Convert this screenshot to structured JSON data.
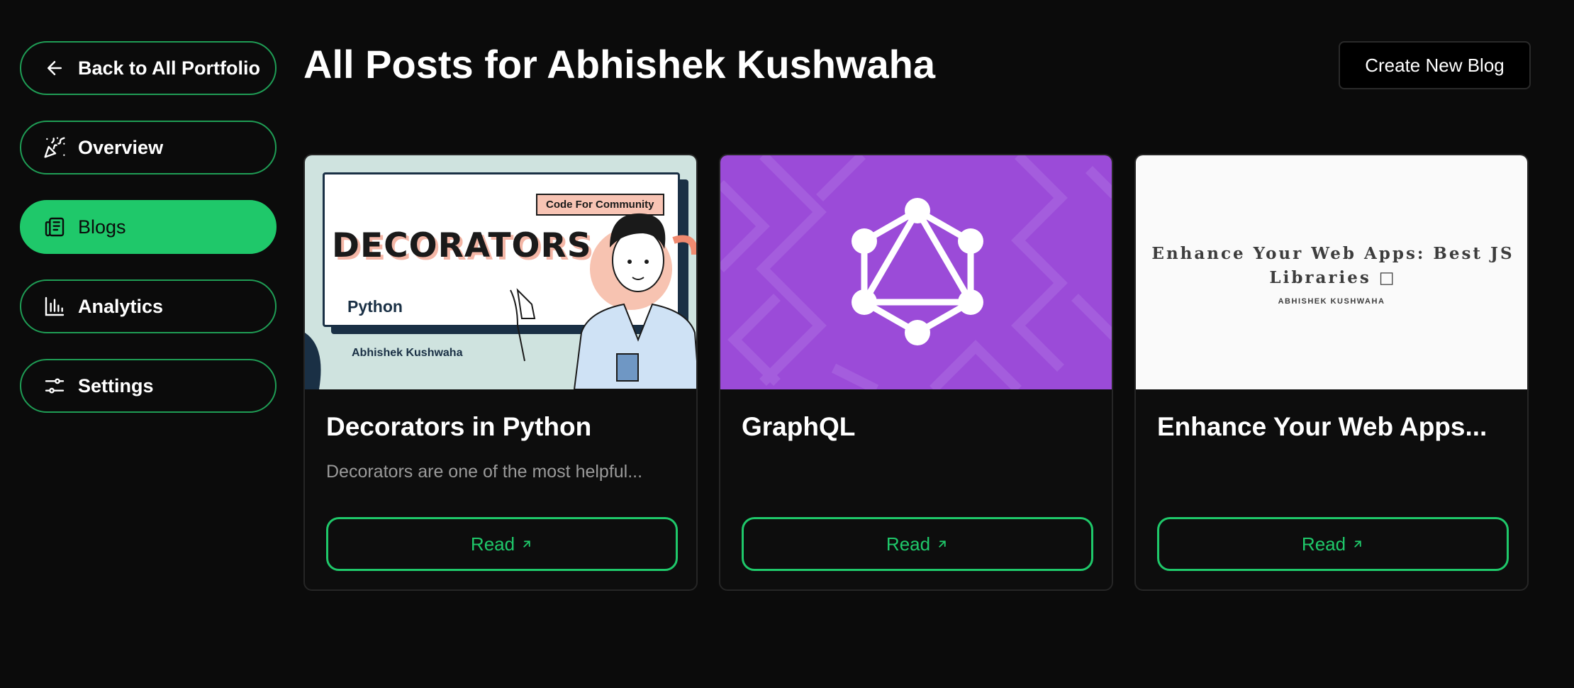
{
  "sidebar": {
    "items": [
      {
        "label": "Back to All Portfolio",
        "icon": "arrow-left-icon"
      },
      {
        "label": "Overview",
        "icon": "party-popper-icon"
      },
      {
        "label": "Blogs",
        "icon": "newspaper-icon",
        "active": true
      },
      {
        "label": "Analytics",
        "icon": "bar-chart-icon"
      },
      {
        "label": "Settings",
        "icon": "sliders-icon"
      }
    ]
  },
  "header": {
    "title": "All Posts for Abhishek Kushwaha",
    "create_label": "Create New Blog"
  },
  "posts": [
    {
      "title": "Decorators in Python",
      "description": "Decorators are one of the most helpful...",
      "read_label": "Read",
      "thumbnail": {
        "headline": "DECORATORS",
        "tag": "Code For Community",
        "language": "Python",
        "author": "Abhishek Kushwaha"
      }
    },
    {
      "title": "GraphQL",
      "description": "",
      "read_label": "Read",
      "thumbnail": {
        "icon": "graphql-logo-icon"
      }
    },
    {
      "title": "Enhance Your Web Apps...",
      "description": "",
      "read_label": "Read",
      "thumbnail": {
        "headline": "Enhance Your Web Apps: Best JS Libraries □",
        "author": "ABHISHEK KUSHWAHA"
      }
    }
  ],
  "colors": {
    "background": "#0b0b0b",
    "accent": "#1fc86a",
    "border": "#1f9d55",
    "graphql_bg": "#9b4bd8"
  }
}
